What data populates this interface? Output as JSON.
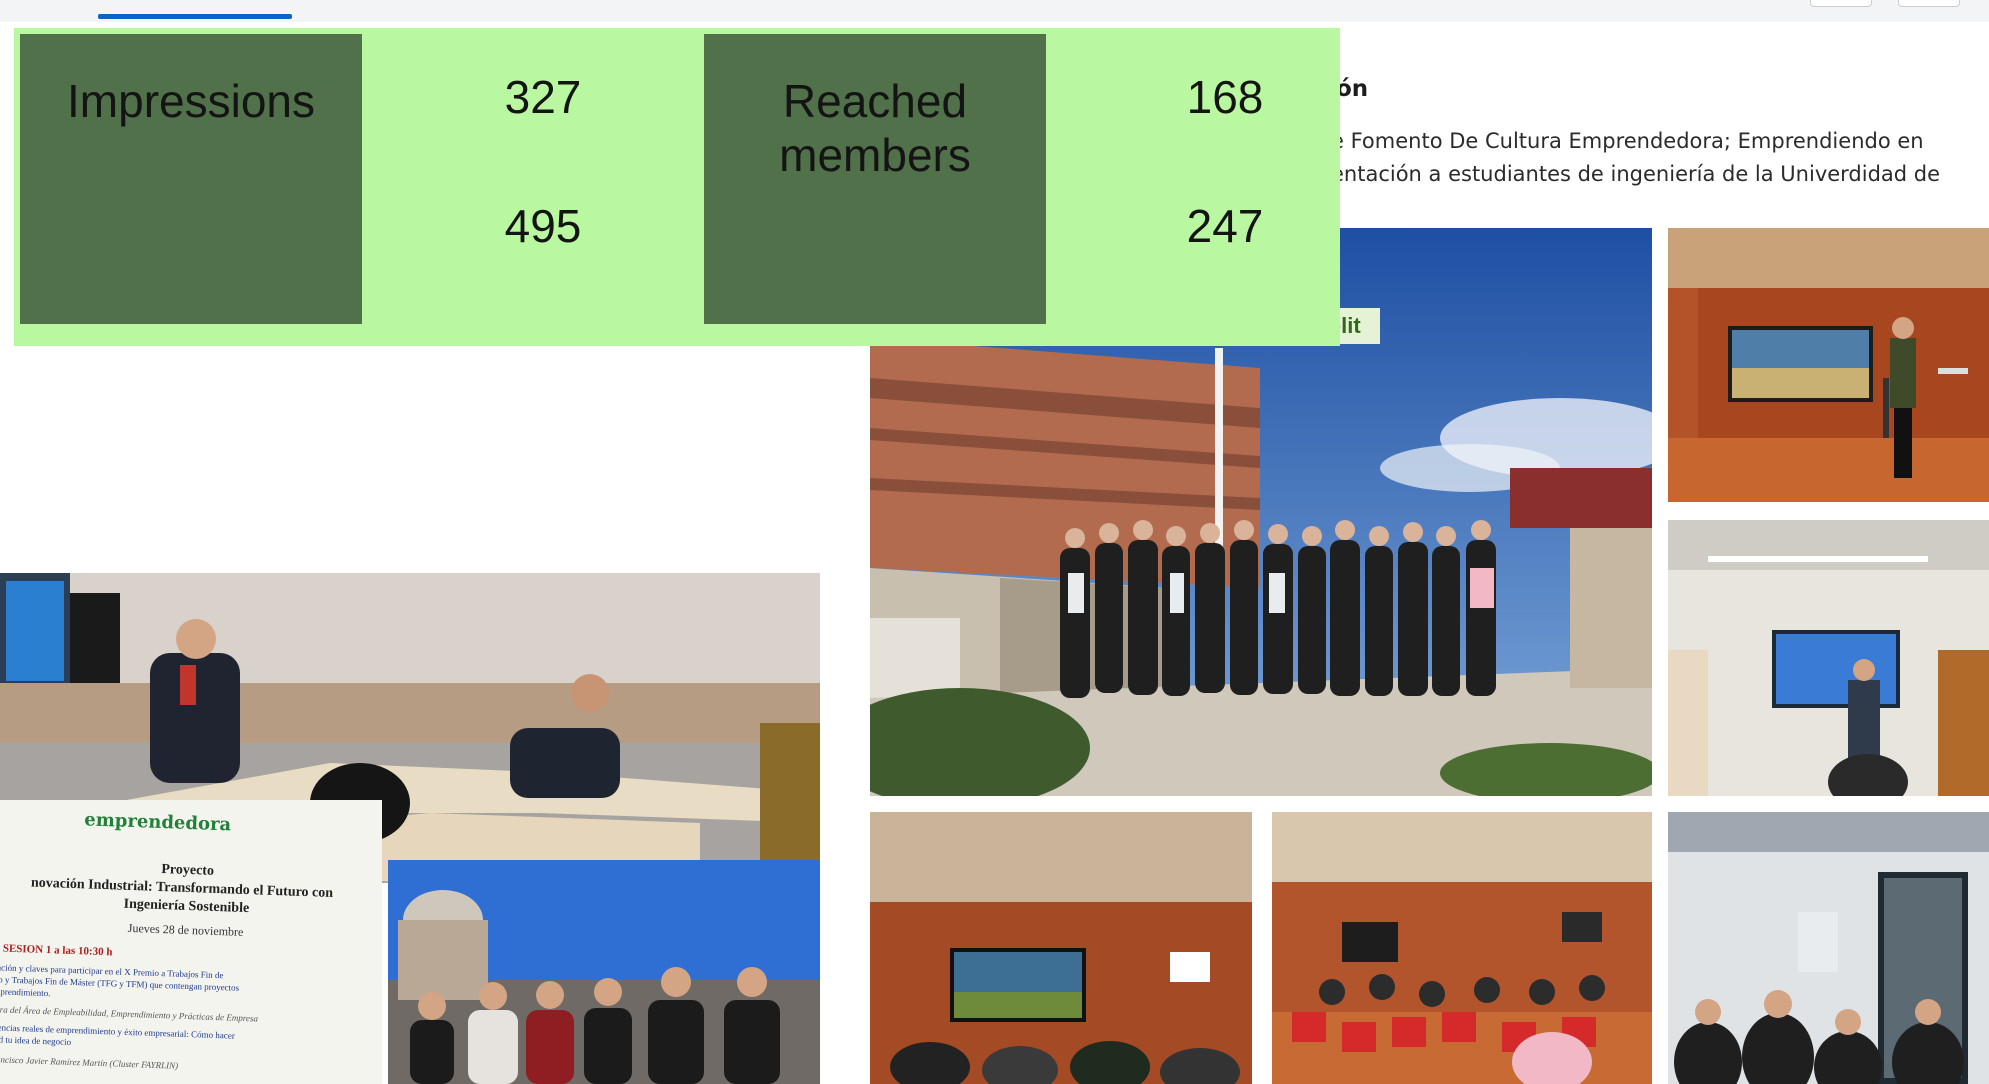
{
  "stats": {
    "impressions_label": "Impressions",
    "impressions_value": "327",
    "impressions_value_2": "495",
    "reached_label_line1": "Reached",
    "reached_label_line2": "members",
    "reached_value": "168",
    "reached_value_2": "247"
  },
  "post": {
    "title": "ón",
    "line1": "e Fomento De Cultura Emprendedora; Emprendiendo en",
    "line2": "entación a estudiantes de ingeniería de la Univerdidad de"
  },
  "poster": {
    "kicker": "emprendedora",
    "title_1": "Proyecto",
    "title_2": "novación Industrial: Transformando el Futuro con",
    "title_3": "Ingeniería Sostenible",
    "date": "Jueves 28 de noviembre",
    "session": "SESION 1        a las 10:30 h",
    "line_1": "ntación y claves para participar en el X Premio a Trabajos Fin de",
    "line_2": "ado y Trabajos Fin de Máster (TFG y TFM) que contengan proyectos",
    "line_3": "emprendimiento.",
    "line_4": "ctora del Área de Empleabilidad, Emprendimiento y Prácticas de Empresa",
    "line_5": "eriencias reales de emprendimiento y éxito empresarial: Cómo hacer",
    "line_6": "idad tu idea de negocio",
    "line_7": "Francisco Javier Ramírez Martín (Cluster FAYRLIN)"
  },
  "signs": {
    "building_sign": "geolit"
  },
  "colors": {
    "stats_background": "#b9f8a0",
    "stats_label_box": "#50714a",
    "tab_underline": "#0a66c2"
  },
  "icons": {
    "active_tab_indicator": "underline"
  }
}
